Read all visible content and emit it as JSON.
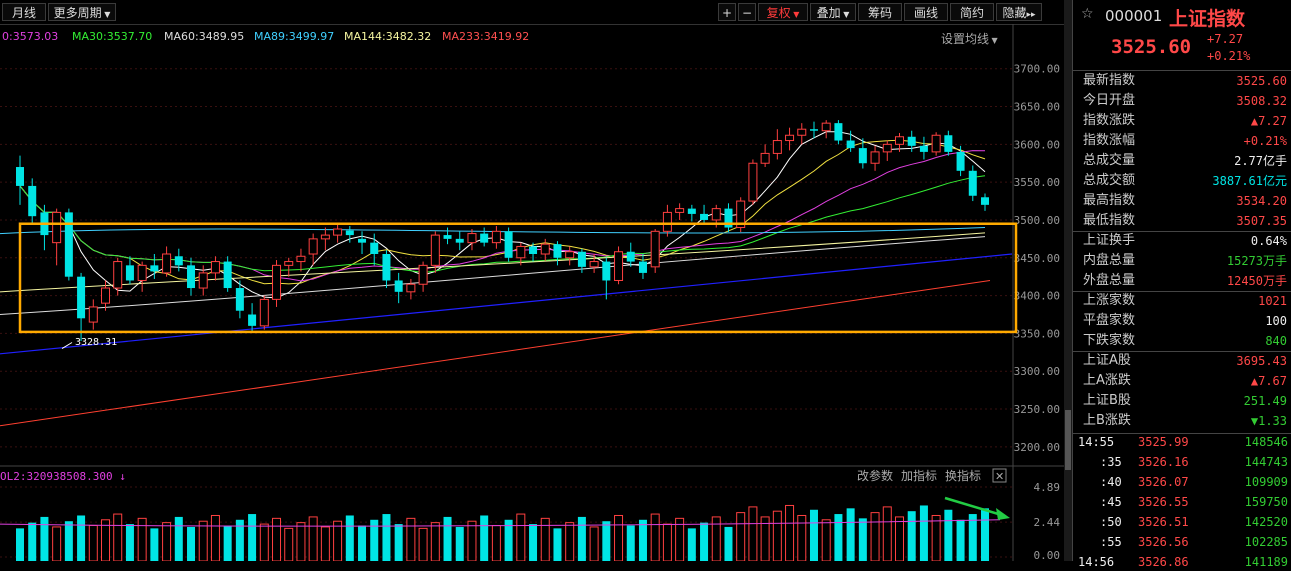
{
  "toolbar": {
    "left": [
      "月线",
      "更多周期"
    ],
    "right": [
      "复权",
      "叠加",
      "筹码",
      "画线",
      "简约",
      "隐藏"
    ],
    "plus": "+",
    "minus": "−",
    "collapse": "▸▸",
    "settings": "设置均线"
  },
  "ma_legend": [
    {
      "label": "0:3573.03",
      "color": "#e040e0"
    },
    {
      "label": "MA30:3537.70",
      "color": "#33ee33"
    },
    {
      "label": "MA60:3489.95",
      "color": "#dddddd"
    },
    {
      "label": "MA89:3499.97",
      "color": "#40d0ff"
    },
    {
      "label": "MA144:3482.32",
      "color": "#f5f5a0"
    },
    {
      "label": "MA233:3419.92",
      "color": "#ff5050"
    }
  ],
  "price_axis": [
    "3700.00",
    "3650.00",
    "3600.00",
    "3550.00",
    "3500.00",
    "3450.00",
    "3400.00",
    "3350.00",
    "3300.00",
    "3250.00",
    "3200.00"
  ],
  "volume_axis": [
    "4.89",
    "2.44",
    "0.00"
  ],
  "volume_legend": "OL2:320938508.300",
  "volume_tabs": [
    "改参数",
    "加指标",
    "换指标"
  ],
  "low_marker": "3328.31",
  "chart_data": {
    "type": "candlestick",
    "ylim": [
      3180,
      3730
    ],
    "candles": [
      [
        3570,
        3545,
        3585,
        3520
      ],
      [
        3545,
        3505,
        3555,
        3495
      ],
      [
        3510,
        3480,
        3520,
        3460
      ],
      [
        3470,
        3510,
        3515,
        3440
      ],
      [
        3510,
        3425,
        3515,
        3420
      ],
      [
        3425,
        3370,
        3430,
        3340
      ],
      [
        3365,
        3385,
        3395,
        3355
      ],
      [
        3390,
        3410,
        3420,
        3380
      ],
      [
        3410,
        3445,
        3450,
        3400
      ],
      [
        3440,
        3420,
        3452,
        3415
      ],
      [
        3420,
        3440,
        3445,
        3405
      ],
      [
        3440,
        3432,
        3455,
        3422
      ],
      [
        3430,
        3455,
        3465,
        3425
      ],
      [
        3452,
        3440,
        3462,
        3432
      ],
      [
        3440,
        3410,
        3450,
        3400
      ],
      [
        3410,
        3430,
        3440,
        3400
      ],
      [
        3430,
        3445,
        3452,
        3420
      ],
      [
        3445,
        3410,
        3452,
        3405
      ],
      [
        3410,
        3380,
        3420,
        3370
      ],
      [
        3375,
        3360,
        3390,
        3352
      ],
      [
        3360,
        3395,
        3400,
        3355
      ],
      [
        3395,
        3440,
        3447,
        3385
      ],
      [
        3440,
        3445,
        3450,
        3425
      ],
      [
        3445,
        3452,
        3462,
        3432
      ],
      [
        3455,
        3475,
        3482,
        3440
      ],
      [
        3475,
        3480,
        3490,
        3460
      ],
      [
        3480,
        3488,
        3495,
        3470
      ],
      [
        3486,
        3480,
        3492,
        3470
      ],
      [
        3475,
        3470,
        3485,
        3455
      ],
      [
        3470,
        3455,
        3482,
        3440
      ],
      [
        3455,
        3420,
        3460,
        3410
      ],
      [
        3420,
        3405,
        3430,
        3390
      ],
      [
        3405,
        3415,
        3422,
        3395
      ],
      [
        3415,
        3440,
        3445,
        3405
      ],
      [
        3440,
        3480,
        3485,
        3430
      ],
      [
        3480,
        3475,
        3490,
        3468
      ],
      [
        3475,
        3470,
        3485,
        3460
      ],
      [
        3470,
        3482,
        3488,
        3460
      ],
      [
        3482,
        3470,
        3490,
        3465
      ],
      [
        3470,
        3485,
        3492,
        3462
      ],
      [
        3485,
        3450,
        3490,
        3445
      ],
      [
        3450,
        3465,
        3470,
        3440
      ],
      [
        3465,
        3455,
        3470,
        3445
      ],
      [
        3455,
        3468,
        3475,
        3446
      ],
      [
        3468,
        3450,
        3472,
        3440
      ],
      [
        3450,
        3458,
        3465,
        3440
      ],
      [
        3458,
        3438,
        3462,
        3430
      ],
      [
        3438,
        3445,
        3455,
        3430
      ],
      [
        3445,
        3420,
        3450,
        3395
      ],
      [
        3420,
        3458,
        3465,
        3415
      ],
      [
        3458,
        3445,
        3470,
        3438
      ],
      [
        3445,
        3430,
        3455,
        3422
      ],
      [
        3438,
        3485,
        3488,
        3430
      ],
      [
        3485,
        3510,
        3520,
        3478
      ],
      [
        3510,
        3515,
        3522,
        3500
      ],
      [
        3515,
        3508,
        3520,
        3498
      ],
      [
        3508,
        3500,
        3520,
        3495
      ],
      [
        3500,
        3515,
        3520,
        3490
      ],
      [
        3515,
        3490,
        3522,
        3484
      ],
      [
        3490,
        3525,
        3530,
        3484
      ],
      [
        3525,
        3575,
        3580,
        3520
      ],
      [
        3575,
        3588,
        3600,
        3570
      ],
      [
        3588,
        3605,
        3620,
        3580
      ],
      [
        3605,
        3612,
        3622,
        3592
      ],
      [
        3612,
        3620,
        3628,
        3600
      ],
      [
        3620,
        3618,
        3630,
        3608
      ],
      [
        3618,
        3628,
        3632,
        3608
      ],
      [
        3628,
        3605,
        3632,
        3600
      ],
      [
        3605,
        3595,
        3618,
        3590
      ],
      [
        3595,
        3575,
        3608,
        3568
      ],
      [
        3575,
        3590,
        3598,
        3565
      ],
      [
        3590,
        3600,
        3605,
        3578
      ],
      [
        3600,
        3610,
        3615,
        3590
      ],
      [
        3610,
        3598,
        3618,
        3590
      ],
      [
        3598,
        3590,
        3610,
        3580
      ],
      [
        3590,
        3612,
        3616,
        3585
      ],
      [
        3612,
        3590,
        3618,
        3585
      ],
      [
        3590,
        3565,
        3598,
        3558
      ],
      [
        3565,
        3532,
        3572,
        3525
      ],
      [
        3530,
        3520,
        3535,
        3512
      ]
    ],
    "volume_ylim": [
      0,
      4.89
    ]
  },
  "sidebar": {
    "code": "000001",
    "name": "上证指数",
    "price": "3525.60",
    "change": "+7.27",
    "change_pct": "+0.21%",
    "stats": [
      {
        "label": "最新指数",
        "value": "3525.60",
        "color": "up"
      },
      {
        "label": "今日开盘",
        "value": "3508.32",
        "color": "up"
      },
      {
        "label": "指数涨跌",
        "value": "▲7.27",
        "color": "up"
      },
      {
        "label": "指数涨幅",
        "value": "+0.21%",
        "color": "up"
      },
      {
        "label": "总成交量",
        "value": "2.77亿手",
        "color": "wh"
      },
      {
        "label": "总成交额",
        "value": "3887.61亿元",
        "color": "cy"
      },
      {
        "label": "最高指数",
        "value": "3534.20",
        "color": "up"
      },
      {
        "label": "最低指数",
        "value": "3507.35",
        "color": "up"
      }
    ],
    "stats2": [
      {
        "label": "上证换手",
        "value": "0.64%",
        "color": "wh"
      },
      {
        "label": "内盘总量",
        "value": "15273万手",
        "color": "dn"
      },
      {
        "label": "外盘总量",
        "value": "12450万手",
        "color": "up"
      }
    ],
    "stats3": [
      {
        "label": "上涨家数",
        "value": "1021",
        "color": "up"
      },
      {
        "label": "平盘家数",
        "value": "100",
        "color": "wh"
      },
      {
        "label": "下跌家数",
        "value": "840",
        "color": "dn"
      }
    ],
    "stats4": [
      {
        "label": "上证A股",
        "value": "3695.43",
        "color": "up"
      },
      {
        "label": "上A涨跌",
        "value": "▲7.67",
        "color": "up"
      },
      {
        "label": "上证B股",
        "value": "251.49",
        "color": "dn"
      },
      {
        "label": "上B涨跌",
        "value": "▼1.33",
        "color": "dn"
      }
    ],
    "ticks": [
      {
        "time": "14:55",
        "price": "3525.99",
        "vol": "148546"
      },
      {
        "time": ":35",
        "price": "3526.16",
        "vol": "144743"
      },
      {
        "time": ":40",
        "price": "3526.07",
        "vol": "109909"
      },
      {
        "time": ":45",
        "price": "3526.55",
        "vol": "159750"
      },
      {
        "time": ":50",
        "price": "3526.51",
        "vol": "142520"
      },
      {
        "time": ":55",
        "price": "3526.56",
        "vol": "102285"
      },
      {
        "time": "14:56",
        "price": "3526.86",
        "vol": "141189"
      }
    ]
  }
}
